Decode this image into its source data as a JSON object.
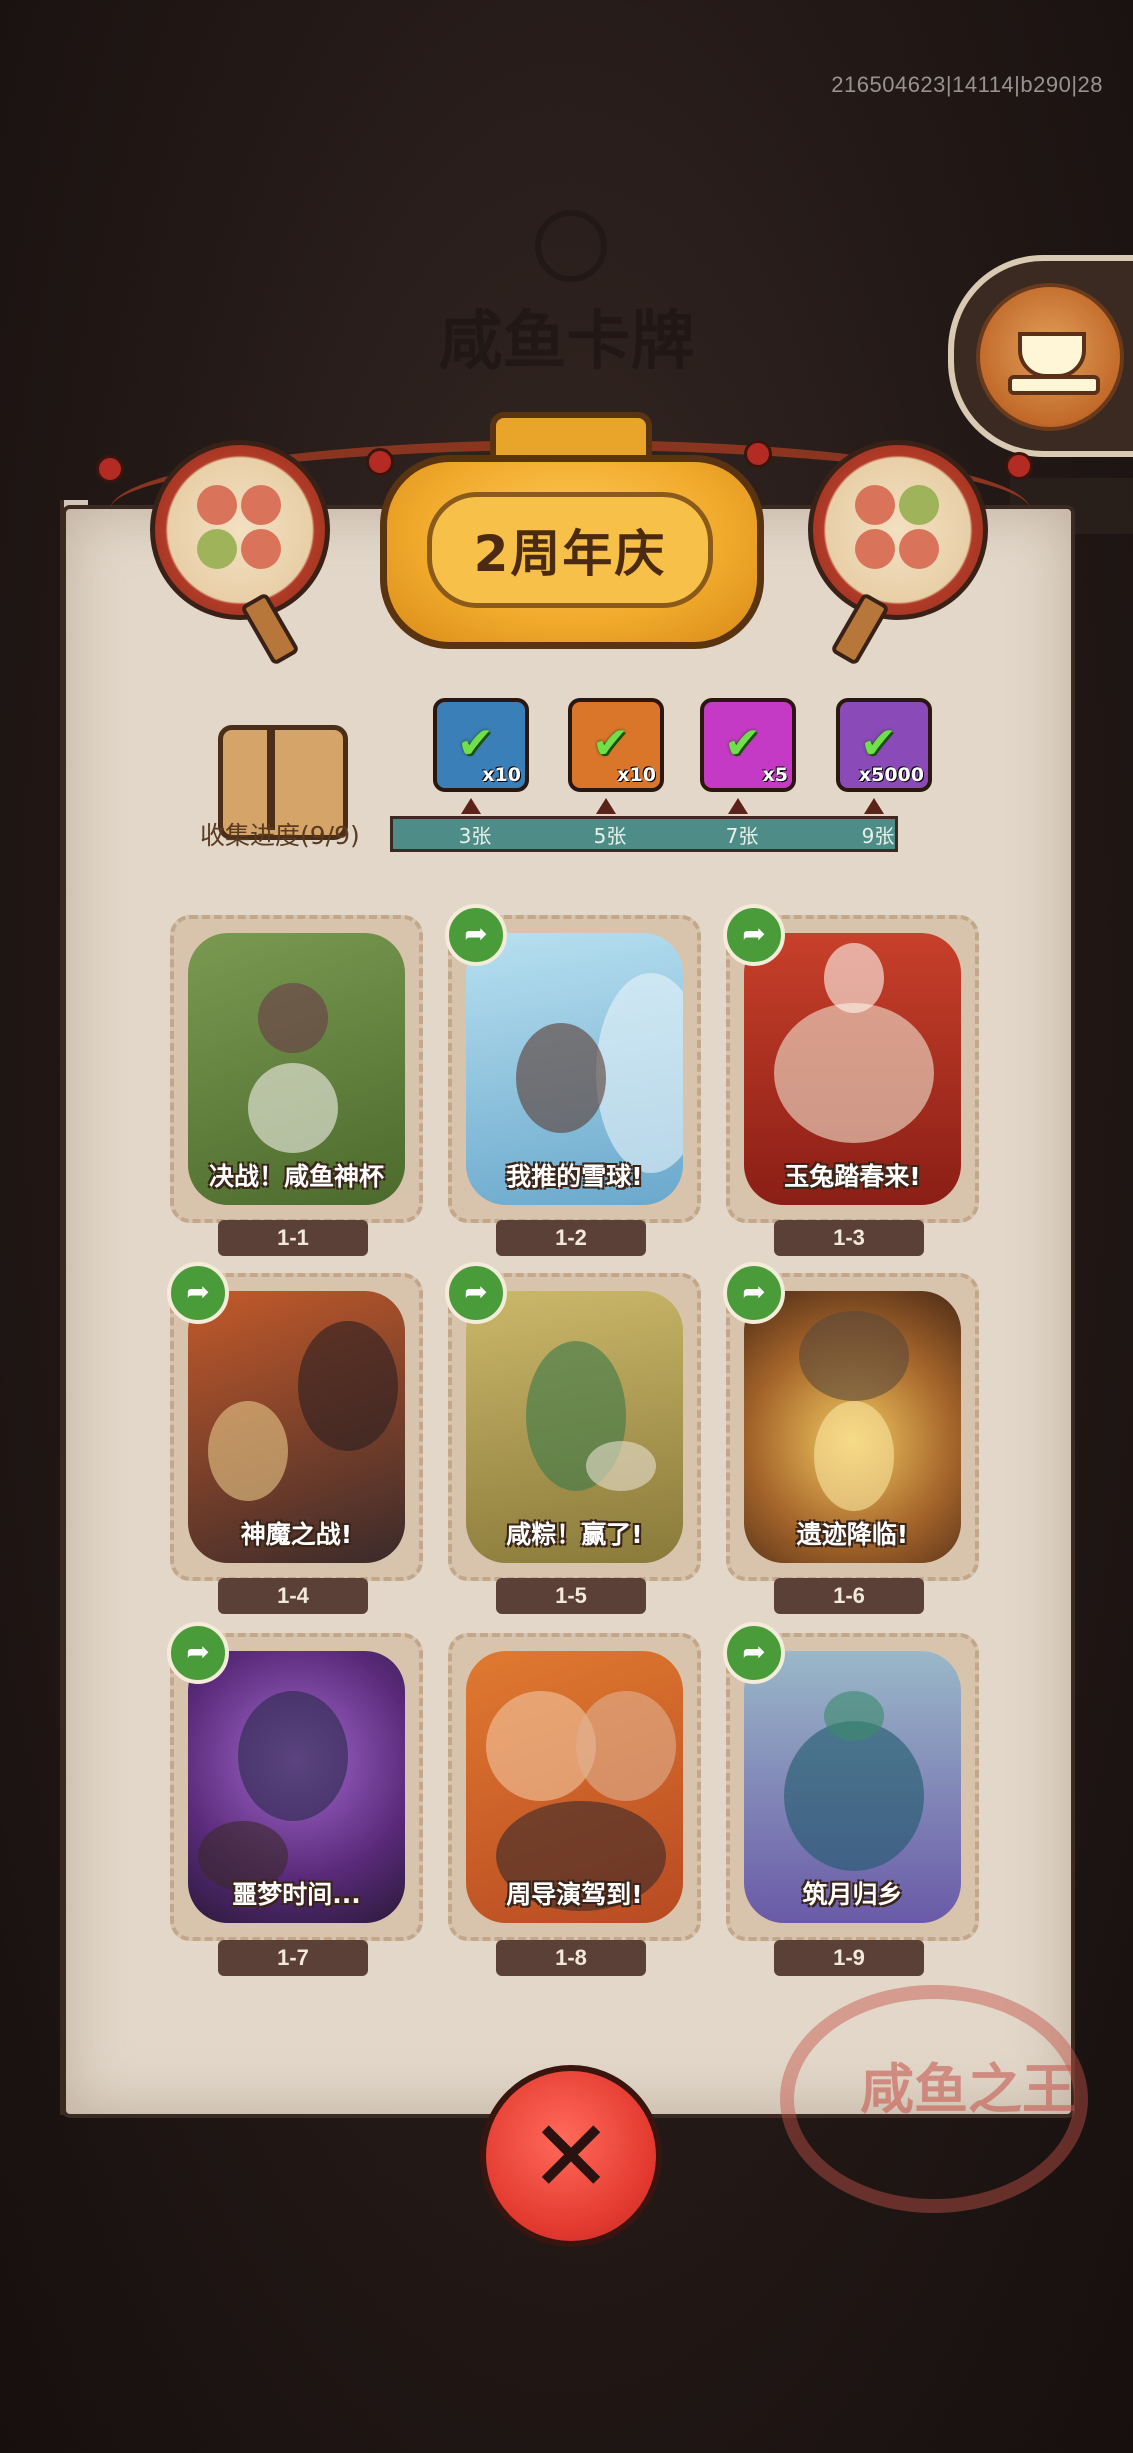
{
  "debug_id": "216504623|14114|b290|28",
  "background_title": "咸鱼卡牌",
  "event_title": "2周年庆",
  "collection": {
    "label": "收集进度(9/9)",
    "milestones": [
      {
        "label": "3张",
        "reward_qty": "x10",
        "color": "#3a7fb8",
        "icon": "chest-icon"
      },
      {
        "label": "5张",
        "reward_qty": "x10",
        "color": "#d9762a",
        "icon": "ticket-icon"
      },
      {
        "label": "7张",
        "reward_qty": "x5",
        "color": "#c43ac4",
        "icon": "orb-icon"
      },
      {
        "label": "9张",
        "reward_qty": "x5000",
        "color": "#8a4ab8",
        "icon": "crystal-icon"
      }
    ]
  },
  "cards": [
    {
      "id": "1-1",
      "title": "决战！咸鱼神杯",
      "shareable": false,
      "art_color": "#5f7a3c"
    },
    {
      "id": "1-2",
      "title": "我推的雪球!",
      "shareable": true,
      "art_color": "#8cc3de"
    },
    {
      "id": "1-3",
      "title": "玉兔踏春来!",
      "shareable": true,
      "art_color": "#b8302a"
    },
    {
      "id": "1-4",
      "title": "神魔之战!",
      "shareable": true,
      "art_color": "#8a3a22"
    },
    {
      "id": "1-5",
      "title": "咸粽！赢了!",
      "shareable": true,
      "art_color": "#a89a4a"
    },
    {
      "id": "1-6",
      "title": "遗迹降临!",
      "shareable": true,
      "art_color": "#7a4a22"
    },
    {
      "id": "1-7",
      "title": "噩梦时间...",
      "shareable": true,
      "art_color": "#6a3a8a"
    },
    {
      "id": "1-8",
      "title": "周导演驾到!",
      "shareable": false,
      "art_color": "#c8642a"
    },
    {
      "id": "1-9",
      "title": "筑月归乡",
      "shareable": true,
      "art_color": "#3a6a8a"
    }
  ],
  "stamp_text": "咸鱼之王",
  "close_label": "✕"
}
